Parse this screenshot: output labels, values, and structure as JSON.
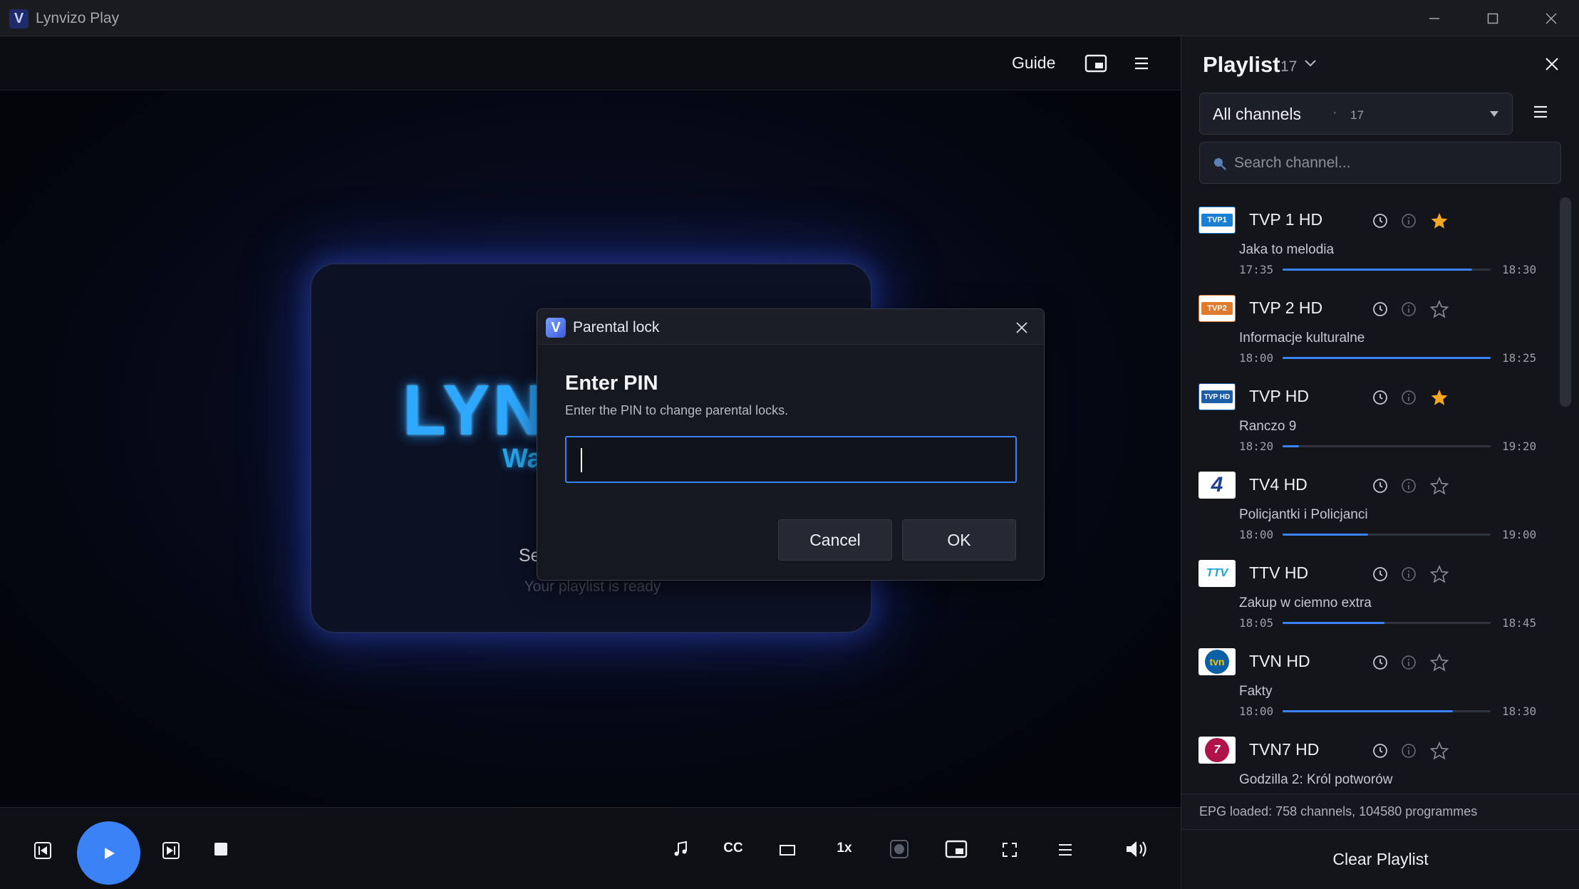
{
  "window": {
    "title": "Lynvizo Play",
    "logo_letter": "V"
  },
  "player": {
    "guide_label": "Guide",
    "welcome": {
      "brand": "LYN",
      "brand_sub": "Wa",
      "text": "Select a channel fr",
      "subtext": "Your playlist is ready"
    },
    "controls": {
      "cc_label": "CC",
      "speed_label": "1x"
    }
  },
  "dialog": {
    "title": "Parental lock",
    "icon_letter": "V",
    "heading": "Enter PIN",
    "description": "Enter the PIN to change parental locks.",
    "pin_value": "",
    "cancel_label": "Cancel",
    "ok_label": "OK"
  },
  "playlist": {
    "title": "Playlist",
    "count": "17",
    "filter": {
      "label": "All channels",
      "separator": "·",
      "count": "17"
    },
    "search_placeholder": "Search channel...",
    "channels": [
      {
        "name": "TVP 1 HD",
        "logo": "TVP1",
        "logo_color": "#1b7fd4",
        "program": "Jaka to melodia",
        "start": "17:35",
        "end": "18:30",
        "progress": 0.91,
        "favorite": true
      },
      {
        "name": "TVP 2 HD",
        "logo": "TVP2",
        "logo_color": "#e07a2c",
        "program": "Informacje kulturalne",
        "start": "18:00",
        "end": "18:25",
        "progress": 1.0,
        "favorite": false
      },
      {
        "name": "TVP HD",
        "logo": "TVP HD",
        "logo_color": "#1e5ea8",
        "program": "Ranczo 9",
        "start": "18:20",
        "end": "19:20",
        "progress": 0.08,
        "favorite": true
      },
      {
        "name": "TV4 HD",
        "logo": "4",
        "logo_color": "#ffffff",
        "program": "Policjantki i Policjanci",
        "start": "18:00",
        "end": "19:00",
        "progress": 0.41,
        "favorite": false
      },
      {
        "name": "TTV HD",
        "logo": "TTV",
        "logo_color": "#ffffff",
        "program": "Zakup w ciemno extra",
        "start": "18:05",
        "end": "18:45",
        "progress": 0.49,
        "favorite": false
      },
      {
        "name": "TVN HD",
        "logo": "tvn",
        "logo_color": "#ffffff",
        "program": "Fakty",
        "start": "18:00",
        "end": "18:30",
        "progress": 0.82,
        "favorite": false
      },
      {
        "name": "TVN7 HD",
        "logo": "7",
        "logo_color": "#ffffff",
        "program": "Godzilla 2: Król potworów",
        "start": "",
        "end": "",
        "progress": 0,
        "favorite": false
      }
    ],
    "epg_status": "EPG loaded: 758 channels, 104580 programmes",
    "clear_label": "Clear Playlist"
  },
  "colors": {
    "accent": "#3b82f6",
    "favorite": "#f5a623"
  }
}
